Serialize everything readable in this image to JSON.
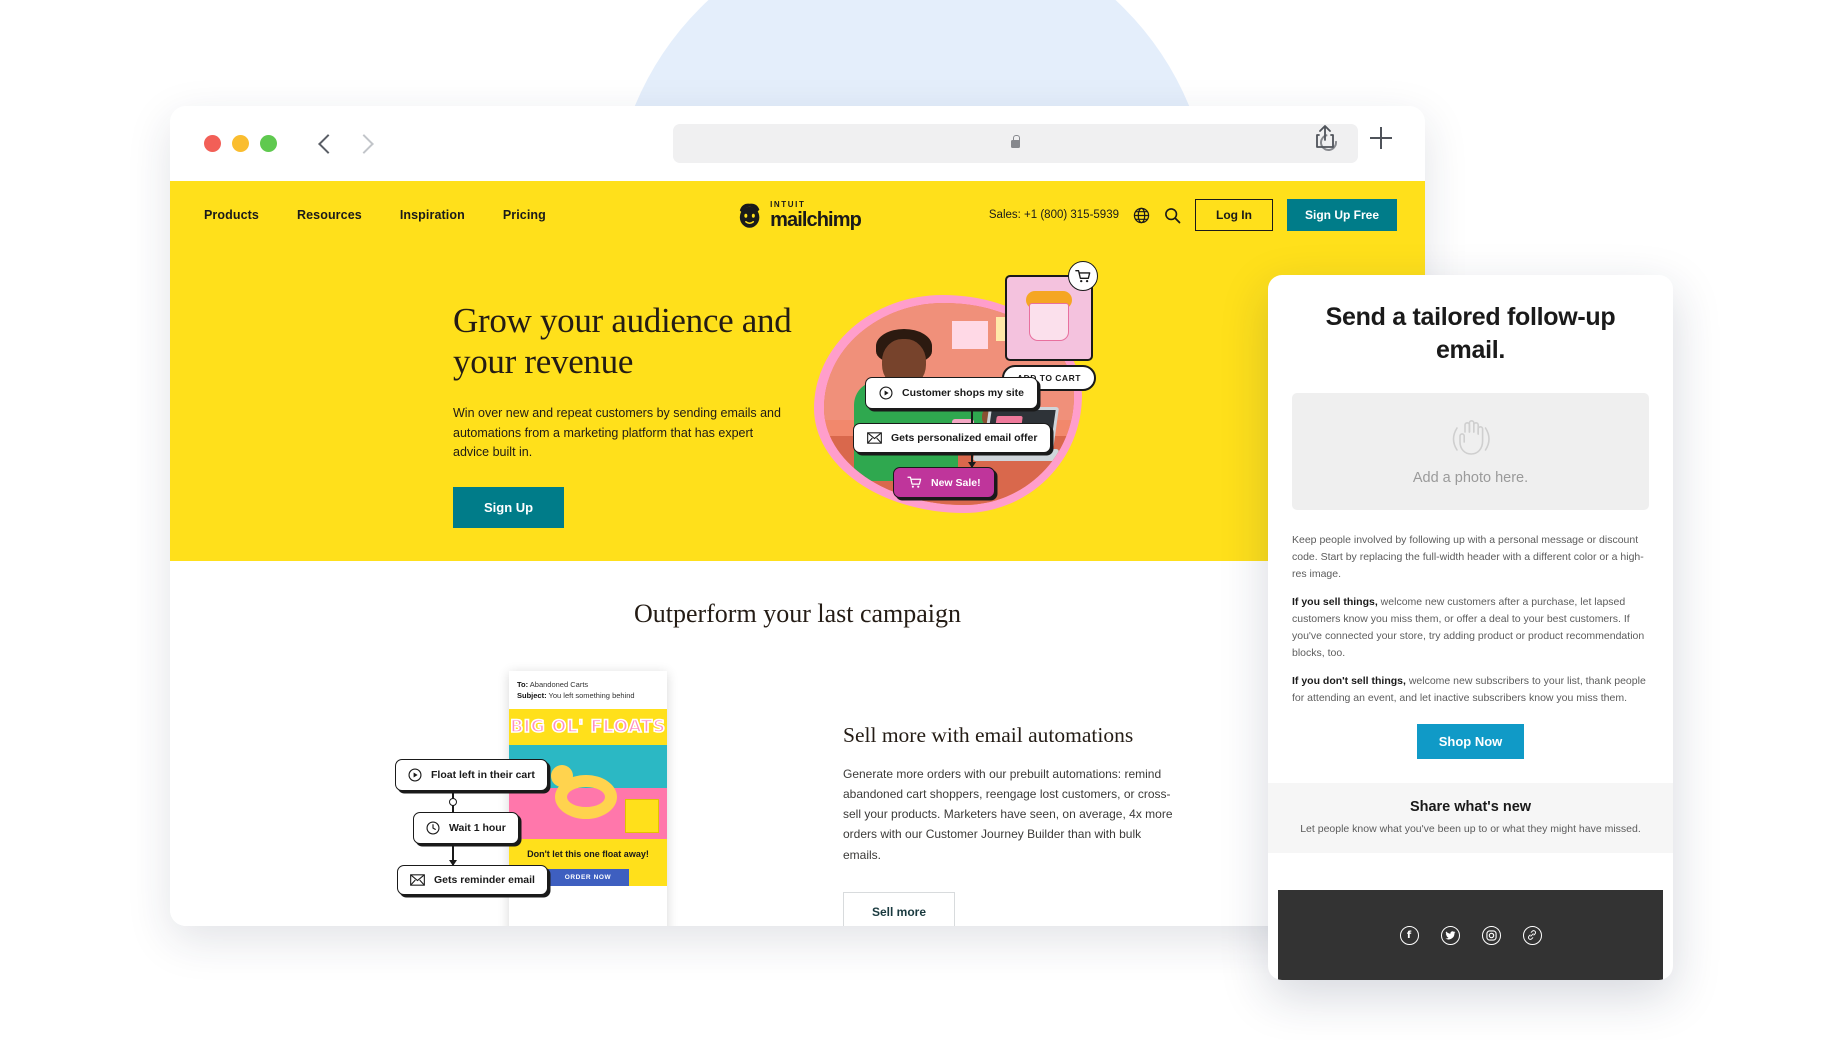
{
  "browser": {
    "traffic_lights": [
      "close",
      "minimize",
      "maximize"
    ],
    "url_value": "",
    "back_icon": "chevron-left-icon",
    "forward_icon": "chevron-right-icon",
    "lock_icon": "lock-icon",
    "reload_icon": "reload-icon",
    "share_icon": "share-icon",
    "new_tab_icon": "plus-icon"
  },
  "site_nav": {
    "links": [
      "Products",
      "Resources",
      "Inspiration",
      "Pricing"
    ],
    "logo_intuit": "INTUIT",
    "logo_name": "mailchimp",
    "sales_phone": "Sales: +1 (800) 315-5939",
    "globe_icon": "globe-icon",
    "search_icon": "search-icon",
    "login_label": "Log In",
    "signup_free_label": "Sign Up Free"
  },
  "hero": {
    "heading": "Grow your audience and your revenue",
    "subtext": "Win over new and repeat customers by sending emails and automations from a marketing platform that has expert advice built in.",
    "cta_label": "Sign Up",
    "add_to_cart_label": "ADD TO CART",
    "cart_badge_icon": "shopping-cart-icon",
    "pills": [
      {
        "label": "Customer shops my site",
        "icon": "play-circle-icon"
      },
      {
        "label": "Gets personalized email offer",
        "icon": "envelope-icon"
      },
      {
        "label": "New Sale!",
        "icon": "shopping-cart-icon"
      }
    ]
  },
  "section": {
    "title": "Outperform your last campaign",
    "email_preview": {
      "to_label": "To:",
      "to_value": "Abandoned Carts",
      "subject_label": "Subject:",
      "subject_value": "You left something behind",
      "banner_title": "BIG OL' FLOATS",
      "cta_text": "Don't let this one float away!",
      "button_label": "ORDER NOW"
    },
    "flow_steps": [
      {
        "label": "Float left in their cart",
        "icon": "play-circle-icon"
      },
      {
        "label": "Wait 1 hour",
        "icon": "clock-icon"
      },
      {
        "label": "Gets reminder email",
        "icon": "envelope-icon"
      }
    ],
    "heading": "Sell more with email automations",
    "paragraph": "Generate more orders with our prebuilt automations: remind abandoned cart shoppers, reengage lost customers, or cross-sell your products. Marketers have seen, on average, 4x more orders with our Customer Journey Builder than with bulk emails.",
    "cta_label": "Sell more"
  },
  "panel": {
    "heading": "Send a tailored follow-up email.",
    "photo_placeholder": "Add a photo here.",
    "hand_icon": "waving-hand-icon",
    "p1": "Keep people involved by following up with a personal message or discount code. Start by replacing the full-width header with a different color or a high-res image.",
    "p2_bold": "If you sell things,",
    "p2": " welcome new customers after a purchase, let lapsed customers know you miss them, or offer a deal to your best customers. If you've connected your store, try adding product or product recommendation blocks, too.",
    "p3_bold": "If you don't sell things,",
    "p3": " welcome new subscribers to your list, thank people for attending an event, and let inactive subscribers know you miss them.",
    "shop_label": "Shop Now",
    "share_title": "Share what's new",
    "share_sub": "Let people know what you've been up to or what they might have missed.",
    "social_icons": [
      "facebook-icon",
      "twitter-icon",
      "instagram-icon",
      "link-icon"
    ]
  },
  "colors": {
    "mailchimp_yellow": "#ffe01b",
    "teal": "#007c89",
    "magenta": "#bf359b",
    "panel_blue": "#109ac7",
    "footer_dark": "#333333"
  }
}
